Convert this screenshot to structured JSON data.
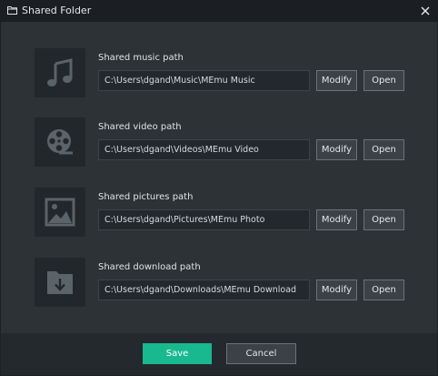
{
  "window": {
    "title": "Shared Folder"
  },
  "colors": {
    "accent": "#19b98f",
    "panel": "#2c3236",
    "tile": "#22272b",
    "icon": "#5a6369"
  },
  "rows": [
    {
      "label": "Shared music path",
      "path": "C:\\Users\\dgand\\Music\\MEmu Music",
      "icon": "music-note-icon",
      "modify_label": "Modify",
      "open_label": "Open"
    },
    {
      "label": "Shared video path",
      "path": "C:\\Users\\dgand\\Videos\\MEmu Video",
      "icon": "film-reel-icon",
      "modify_label": "Modify",
      "open_label": "Open"
    },
    {
      "label": "Shared pictures path",
      "path": "C:\\Users\\dgand\\Pictures\\MEmu Photo",
      "icon": "picture-icon",
      "modify_label": "Modify",
      "open_label": "Open"
    },
    {
      "label": "Shared download path",
      "path": "C:\\Users\\dgand\\Downloads\\MEmu Download",
      "icon": "download-folder-icon",
      "modify_label": "Modify",
      "open_label": "Open"
    }
  ],
  "footer": {
    "save_label": "Save",
    "cancel_label": "Cancel"
  }
}
